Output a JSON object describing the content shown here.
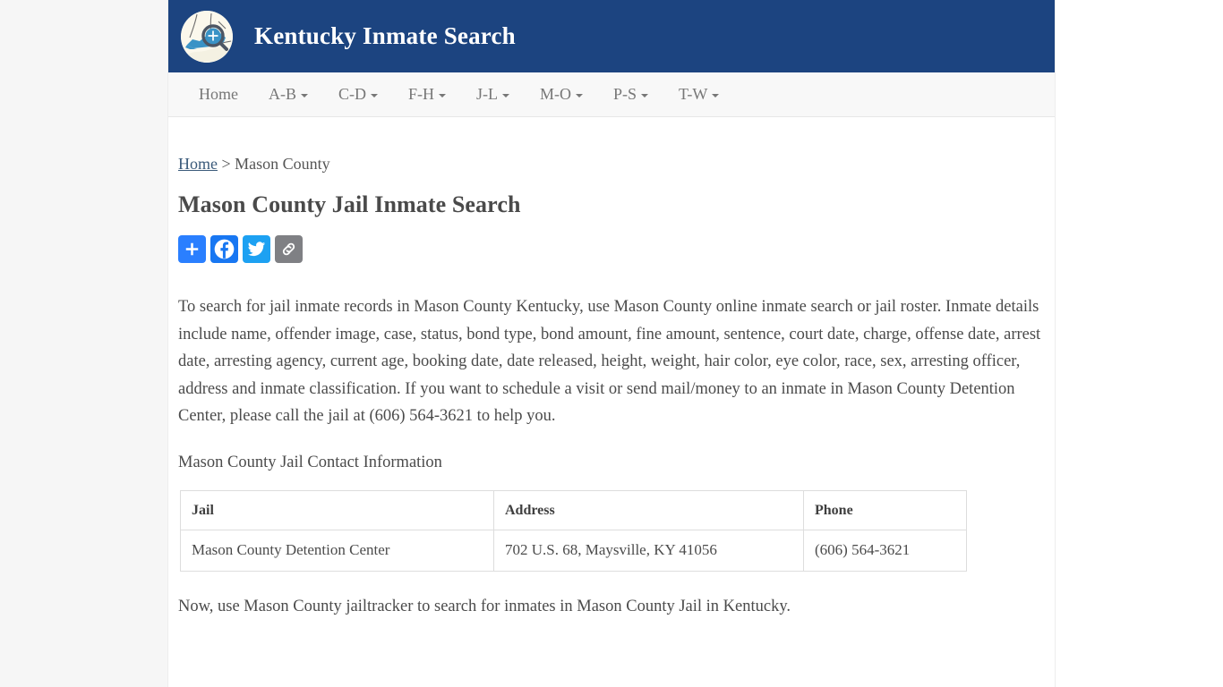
{
  "site": {
    "brand_title": "Kentucky Inmate Search",
    "logo_icon": "kentucky-map-magnifier-icon",
    "header_bg": "#1c4480",
    "nav_bg": "#f8f8f8"
  },
  "nav": {
    "items": [
      {
        "label": "Home",
        "has_caret": false
      },
      {
        "label": "A-B",
        "has_caret": true
      },
      {
        "label": "C-D",
        "has_caret": true
      },
      {
        "label": "F-H",
        "has_caret": true
      },
      {
        "label": "J-L",
        "has_caret": true
      },
      {
        "label": "M-O",
        "has_caret": true
      },
      {
        "label": "P-S",
        "has_caret": true
      },
      {
        "label": "T-W",
        "has_caret": true
      }
    ]
  },
  "breadcrumb": {
    "home_label": "Home",
    "separator": ">",
    "current_label": "Mason County"
  },
  "main": {
    "page_title": "Mason County Jail Inmate Search",
    "intro_paragraph": "To search for jail inmate records in Mason County Kentucky, use Mason County online inmate search or jail roster. Inmate details include name, offender image, case, status, bond type, bond amount, fine amount, sentence, court date, charge, offense date, arrest date, arresting agency, current age, booking date, date released, height, weight, hair color, eye color, race, sex, arresting officer, address and inmate classification. If you want to schedule a visit or send mail/money to an inmate in Mason County Detention Center, please call the jail at (606) 564-3621 to help you.",
    "contact_heading": "Mason County Jail Contact Information",
    "closing_paragraph": "Now, use Mason County jailtracker to search for inmates in Mason County Jail in Kentucky."
  },
  "share": {
    "buttons": [
      {
        "name": "addthis-share-button",
        "icon": "plus-icon",
        "color": "#2a7fff"
      },
      {
        "name": "facebook-share-button",
        "icon": "facebook-icon",
        "color": "#1877f2"
      },
      {
        "name": "twitter-share-button",
        "icon": "twitter-bird-icon",
        "color": "#1da1f2"
      },
      {
        "name": "copy-link-button",
        "icon": "chain-link-icon",
        "color": "#7f8084"
      }
    ]
  },
  "contact_table": {
    "headers": [
      "Jail",
      "Address",
      "Phone"
    ],
    "rows": [
      [
        "Mason County Detention Center",
        "702 U.S. 68, Maysville, KY 41056",
        "(606) 564-3621"
      ]
    ]
  }
}
